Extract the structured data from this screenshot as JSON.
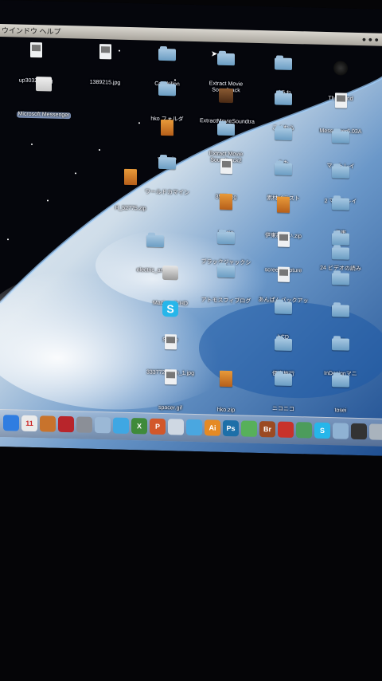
{
  "menubar": {
    "left_text": "ウインドウ  ヘルプ",
    "right_text": "● ● ●"
  },
  "desktop_icons": [
    {
      "label": "up303299.jpg",
      "kind": "file",
      "icon": "image-file-icon"
    },
    {
      "label": "1389215.jpg",
      "kind": "file",
      "icon": "image-file-icon"
    },
    {
      "label": "Cendrillon",
      "kind": "folder",
      "icon": "folder-icon"
    },
    {
      "label": "Extract Movie\nSoundtrack",
      "kind": "folder",
      "icon": "folder-icon"
    },
    {
      "label": "ごうれ",
      "kind": "folder",
      "icon": "folder-icon"
    },
    {
      "label": "Thousand",
      "kind": "orb",
      "icon": "app-icon"
    },
    {
      "label": "Microsoft Messenger",
      "kind": "app",
      "icon": "messenger-app-icon",
      "selected": true
    },
    {
      "label": "hko フォルダ",
      "kind": "folder",
      "icon": "folder-icon"
    },
    {
      "label": "ExtractMovieSoundtra\nck.sit",
      "kind": "sit",
      "icon": "archive-icon"
    },
    {
      "label": "こくむら",
      "kind": "folder",
      "icon": "folder-icon"
    },
    {
      "label": "Messenger6.03A",
      "kind": "file",
      "icon": "installer-file-icon"
    },
    {
      "label": "wim.zip",
      "kind": "zip",
      "icon": "zip-file-icon"
    },
    {
      "label": "Extract Movie\nSoundtrack2",
      "kind": "folder",
      "icon": "folder-icon"
    },
    {
      "label": "うた",
      "kind": "folder",
      "icon": "folder-icon"
    },
    {
      "label": "マットレイ",
      "kind": "folder",
      "icon": "folder-icon"
    },
    {
      "label": "ワールドカマイン",
      "kind": "folder",
      "icon": "folder-icon"
    },
    {
      "label": "3535.jpg",
      "kind": "file",
      "icon": "image-file-icon"
    },
    {
      "label": "素材イラスト",
      "kind": "folder",
      "icon": "folder-icon"
    },
    {
      "label": "2 マスクレイ",
      "kind": "folder",
      "icon": "folder-icon"
    },
    {
      "label": "H_52775.zip",
      "kind": "zip",
      "icon": "zip-file-icon"
    },
    {
      "label": "伊東",
      "kind": "folder",
      "icon": "folder-icon"
    },
    {
      "label": "b4.zip",
      "kind": "zip",
      "icon": "zip-file-icon"
    },
    {
      "label": "伊東新しい.zip",
      "kind": "zip",
      "icon": "zip-file-icon"
    },
    {
      "label": "24 ビデオの読み",
      "kind": "folder",
      "icon": "folder-icon"
    },
    {
      "label": "electric_angels",
      "kind": "folder",
      "icon": "folder-icon"
    },
    {
      "label": "ブラックジャックシーズン",
      "kind": "folder",
      "icon": "folder-icon"
    },
    {
      "label": "screen-capture",
      "kind": "file",
      "icon": "image-file-icon"
    },
    {
      "label": "4656",
      "kind": "folder",
      "icon": "folder-icon"
    },
    {
      "label": "Macintosh HD",
      "kind": "disk",
      "icon": "hard-disk-icon"
    },
    {
      "label": "アトモスフィブログ",
      "kind": "folder",
      "icon": "folder-icon"
    },
    {
      "label": "あんぱんバックアップ",
      "kind": "file",
      "icon": "document-file-icon"
    },
    {
      "label": "hiroshi",
      "kind": "folder",
      "icon": "folder-icon"
    },
    {
      "label": "Skype",
      "kind": "skype",
      "icon": "skype-app-icon"
    },
    {
      "label": "bCD",
      "kind": "folder",
      "icon": "folder-icon"
    },
    {
      "label": "img",
      "kind": "folder",
      "icon": "folder-icon"
    },
    {
      "label": "33377209_m_1.jpg",
      "kind": "file",
      "icon": "image-file-icon"
    },
    {
      "label": "伊東旅行",
      "kind": "folder",
      "icon": "folder-icon"
    },
    {
      "label": "InDesignマニ",
      "kind": "folder",
      "icon": "folder-icon"
    },
    {
      "label": "spacer.gif",
      "kind": "file",
      "icon": "image-file-icon"
    },
    {
      "label": "hko.zip",
      "kind": "zip",
      "icon": "zip-file-icon"
    },
    {
      "label": "ニコニコ",
      "kind": "folder",
      "icon": "folder-icon"
    },
    {
      "label": "tosei",
      "kind": "folder",
      "icon": "folder-icon"
    }
  ],
  "dock_items": [
    {
      "name": "finder-icon",
      "color": "#2f7de1",
      "text": ""
    },
    {
      "name": "calendar-icon",
      "color": "#eaeaea",
      "text": "11"
    },
    {
      "name": "address-book-icon",
      "color": "#c8732c",
      "text": ""
    },
    {
      "name": "photo-booth-icon",
      "color": "#b8252b",
      "text": ""
    },
    {
      "name": "system-preferences-icon",
      "color": "#8b8f97",
      "text": ""
    },
    {
      "name": "mail-icon",
      "color": "#9bb8d6",
      "text": ""
    },
    {
      "name": "safari-icon",
      "color": "#3fa7e3",
      "text": ""
    },
    {
      "name": "excel-icon",
      "color": "#3f8a3a",
      "text": "X"
    },
    {
      "name": "powerpoint-icon",
      "color": "#d2572a",
      "text": "P"
    },
    {
      "name": "preview-icon",
      "color": "#cfd8e3",
      "text": ""
    },
    {
      "name": "itunes-icon",
      "color": "#4aa7e0",
      "text": ""
    },
    {
      "name": "illustrator-icon",
      "color": "#e58a24",
      "text": "Ai"
    },
    {
      "name": "photoshop-icon",
      "color": "#1d6fa8",
      "text": "Ps"
    },
    {
      "name": "messenger-icon",
      "color": "#57b05a",
      "text": ""
    },
    {
      "name": "bridge-icon",
      "color": "#9b4a22",
      "text": "Br"
    },
    {
      "name": "flash-icon",
      "color": "#c8322b",
      "text": ""
    },
    {
      "name": "app-store-icon",
      "color": "#4c9c5c",
      "text": ""
    },
    {
      "name": "skype-icon",
      "color": "#26b6ea",
      "text": "S"
    },
    {
      "name": "downloads-icon",
      "color": "#8fb2d3",
      "text": ""
    },
    {
      "name": "dashboard-icon",
      "color": "#333333",
      "text": ""
    },
    {
      "name": "trash-icon",
      "color": "#a9b3bd",
      "text": ""
    }
  ]
}
